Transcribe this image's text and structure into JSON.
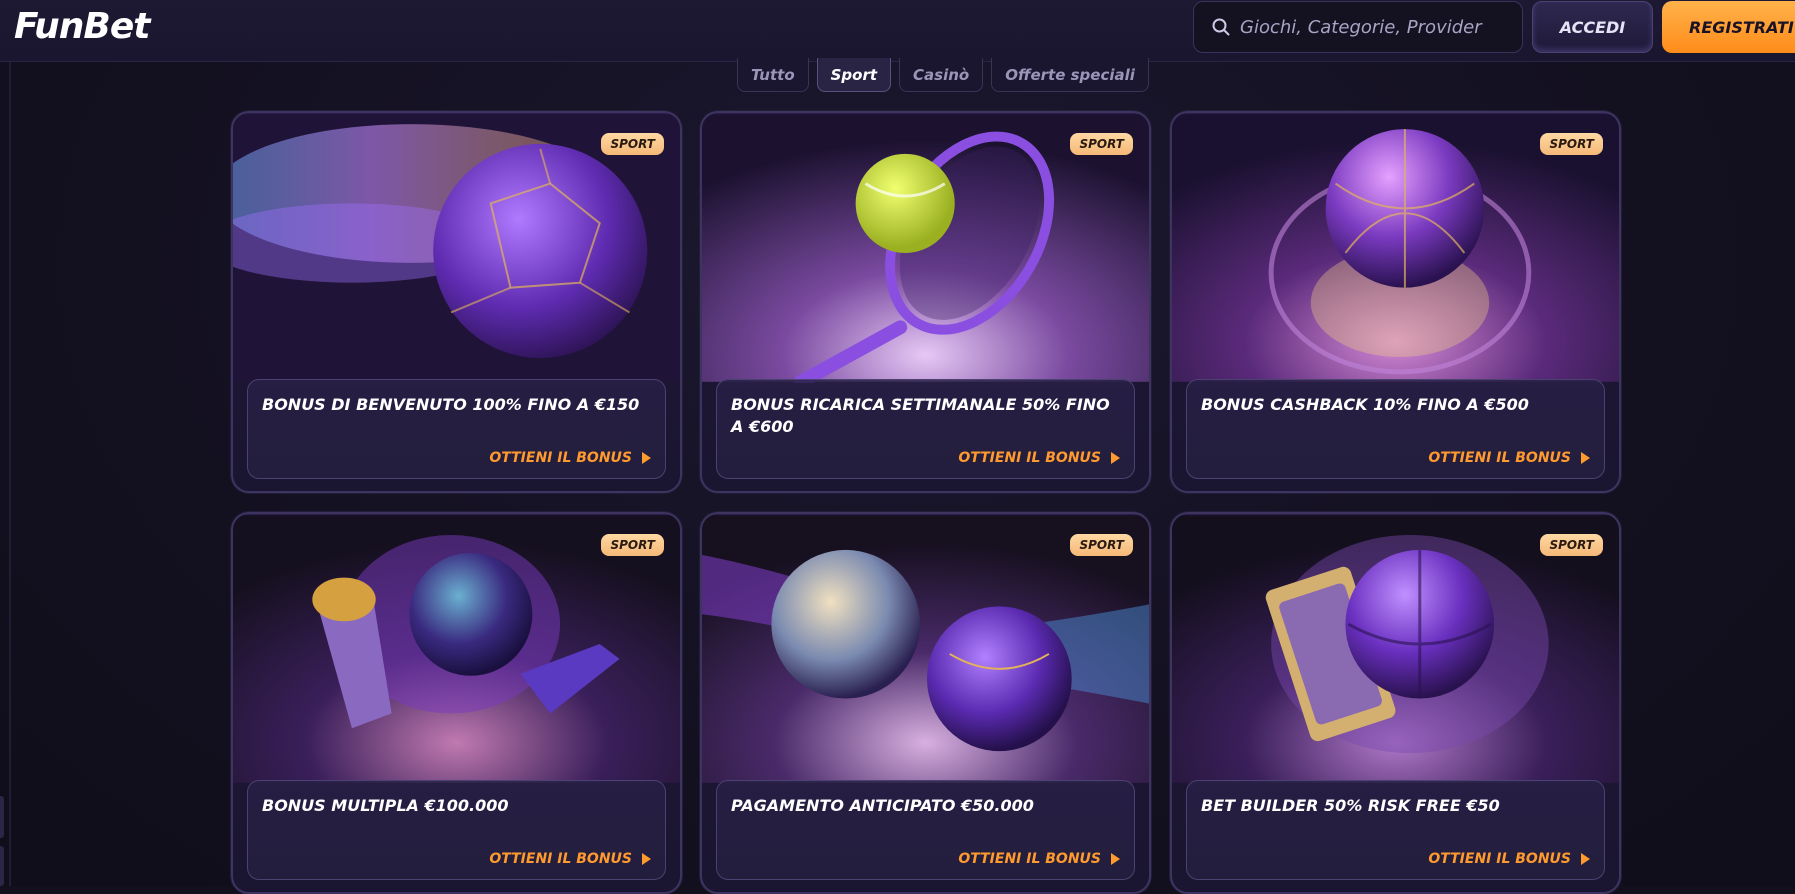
{
  "header": {
    "logo": "FunBet",
    "search_placeholder": "Giochi, Categorie, Provider",
    "login_label": "ACCEDI",
    "register_label": "REGISTRATI"
  },
  "tabs": [
    {
      "label": "Tutto",
      "active": false
    },
    {
      "label": "Sport",
      "active": true
    },
    {
      "label": "Casinò",
      "active": false
    },
    {
      "label": "Offerte speciali",
      "active": false
    }
  ],
  "cards": [
    {
      "badge": "SPORT",
      "title": "BONUS DI BENVENUTO 100% FINO A €150",
      "cta": "OTTIENI IL BONUS",
      "icon": "soccer-ball-icon"
    },
    {
      "badge": "SPORT",
      "title": "BONUS RICARICA SETTIMANALE 50% FINO A €600",
      "cta": "OTTIENI IL BONUS",
      "icon": "tennis-icon"
    },
    {
      "badge": "SPORT",
      "title": "BONUS CASHBACK 10% FINO A €500",
      "cta": "OTTIENI IL BONUS",
      "icon": "basketball-icon"
    },
    {
      "badge": "SPORT",
      "title": "BONUS MULTIPLA €100.000",
      "cta": "OTTIENI IL BONUS",
      "icon": "soccer-fan-icon"
    },
    {
      "badge": "SPORT",
      "title": "PAGAMENTO ANTICIPATO €50.000",
      "cta": "OTTIENI IL BONUS",
      "icon": "two-balls-icon"
    },
    {
      "badge": "SPORT",
      "title": "BET BUILDER 50% RISK FREE €50",
      "cta": "OTTIENI IL BONUS",
      "icon": "basketball-board-icon"
    }
  ],
  "colors": {
    "accent_orange": "#ff9a2e",
    "badge_bg": "#f5b877",
    "card_border": "#3d3560",
    "purple": "#8a4fe0"
  }
}
